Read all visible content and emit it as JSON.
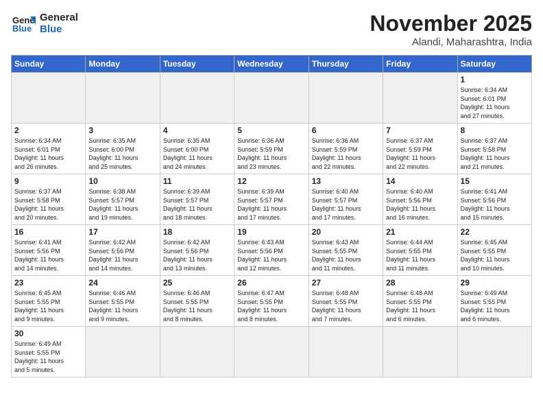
{
  "header": {
    "logo_line1": "General",
    "logo_line2": "Blue",
    "month": "November 2025",
    "location": "Alandi, Maharashtra, India"
  },
  "weekdays": [
    "Sunday",
    "Monday",
    "Tuesday",
    "Wednesday",
    "Thursday",
    "Friday",
    "Saturday"
  ],
  "weeks": [
    [
      {
        "day": "",
        "info": ""
      },
      {
        "day": "",
        "info": ""
      },
      {
        "day": "",
        "info": ""
      },
      {
        "day": "",
        "info": ""
      },
      {
        "day": "",
        "info": ""
      },
      {
        "day": "",
        "info": ""
      },
      {
        "day": "1",
        "info": "Sunrise: 6:34 AM\nSunset: 6:01 PM\nDaylight: 11 hours\nand 27 minutes."
      }
    ],
    [
      {
        "day": "2",
        "info": "Sunrise: 6:34 AM\nSunset: 6:01 PM\nDaylight: 11 hours\nand 26 minutes."
      },
      {
        "day": "3",
        "info": "Sunrise: 6:35 AM\nSunset: 6:00 PM\nDaylight: 11 hours\nand 25 minutes."
      },
      {
        "day": "4",
        "info": "Sunrise: 6:35 AM\nSunset: 6:00 PM\nDaylight: 11 hours\nand 24 minutes."
      },
      {
        "day": "5",
        "info": "Sunrise: 6:36 AM\nSunset: 5:59 PM\nDaylight: 11 hours\nand 23 minutes."
      },
      {
        "day": "6",
        "info": "Sunrise: 6:36 AM\nSunset: 5:59 PM\nDaylight: 11 hours\nand 22 minutes."
      },
      {
        "day": "7",
        "info": "Sunrise: 6:37 AM\nSunset: 5:59 PM\nDaylight: 11 hours\nand 22 minutes."
      },
      {
        "day": "8",
        "info": "Sunrise: 6:37 AM\nSunset: 5:58 PM\nDaylight: 11 hours\nand 21 minutes."
      }
    ],
    [
      {
        "day": "9",
        "info": "Sunrise: 6:37 AM\nSunset: 5:58 PM\nDaylight: 11 hours\nand 20 minutes."
      },
      {
        "day": "10",
        "info": "Sunrise: 6:38 AM\nSunset: 5:57 PM\nDaylight: 11 hours\nand 19 minutes."
      },
      {
        "day": "11",
        "info": "Sunrise: 6:39 AM\nSunset: 5:57 PM\nDaylight: 11 hours\nand 18 minutes."
      },
      {
        "day": "12",
        "info": "Sunrise: 6:39 AM\nSunset: 5:57 PM\nDaylight: 11 hours\nand 17 minutes."
      },
      {
        "day": "13",
        "info": "Sunrise: 6:40 AM\nSunset: 5:57 PM\nDaylight: 11 hours\nand 17 minutes."
      },
      {
        "day": "14",
        "info": "Sunrise: 6:40 AM\nSunset: 5:56 PM\nDaylight: 11 hours\nand 16 minutes."
      },
      {
        "day": "15",
        "info": "Sunrise: 6:41 AM\nSunset: 5:56 PM\nDaylight: 11 hours\nand 15 minutes."
      }
    ],
    [
      {
        "day": "16",
        "info": "Sunrise: 6:41 AM\nSunset: 5:56 PM\nDaylight: 11 hours\nand 14 minutes."
      },
      {
        "day": "17",
        "info": "Sunrise: 6:42 AM\nSunset: 5:56 PM\nDaylight: 11 hours\nand 14 minutes."
      },
      {
        "day": "18",
        "info": "Sunrise: 6:42 AM\nSunset: 5:56 PM\nDaylight: 11 hours\nand 13 minutes."
      },
      {
        "day": "19",
        "info": "Sunrise: 6:43 AM\nSunset: 5:56 PM\nDaylight: 11 hours\nand 12 minutes."
      },
      {
        "day": "20",
        "info": "Sunrise: 6:43 AM\nSunset: 5:55 PM\nDaylight: 11 hours\nand 11 minutes."
      },
      {
        "day": "21",
        "info": "Sunrise: 6:44 AM\nSunset: 5:55 PM\nDaylight: 11 hours\nand 11 minutes."
      },
      {
        "day": "22",
        "info": "Sunrise: 6:45 AM\nSunset: 5:55 PM\nDaylight: 11 hours\nand 10 minutes."
      }
    ],
    [
      {
        "day": "23",
        "info": "Sunrise: 6:45 AM\nSunset: 5:55 PM\nDaylight: 11 hours\nand 9 minutes."
      },
      {
        "day": "24",
        "info": "Sunrise: 6:46 AM\nSunset: 5:55 PM\nDaylight: 11 hours\nand 9 minutes."
      },
      {
        "day": "25",
        "info": "Sunrise: 6:46 AM\nSunset: 5:55 PM\nDaylight: 11 hours\nand 8 minutes."
      },
      {
        "day": "26",
        "info": "Sunrise: 6:47 AM\nSunset: 5:55 PM\nDaylight: 11 hours\nand 8 minutes."
      },
      {
        "day": "27",
        "info": "Sunrise: 6:48 AM\nSunset: 5:55 PM\nDaylight: 11 hours\nand 7 minutes."
      },
      {
        "day": "28",
        "info": "Sunrise: 6:48 AM\nSunset: 5:55 PM\nDaylight: 11 hours\nand 6 minutes."
      },
      {
        "day": "29",
        "info": "Sunrise: 6:49 AM\nSunset: 5:55 PM\nDaylight: 11 hours\nand 6 minutes."
      }
    ],
    [
      {
        "day": "30",
        "info": "Sunrise: 6:49 AM\nSunset: 5:55 PM\nDaylight: 11 hours\nand 5 minutes."
      },
      {
        "day": "",
        "info": ""
      },
      {
        "day": "",
        "info": ""
      },
      {
        "day": "",
        "info": ""
      },
      {
        "day": "",
        "info": ""
      },
      {
        "day": "",
        "info": ""
      },
      {
        "day": "",
        "info": ""
      }
    ]
  ]
}
